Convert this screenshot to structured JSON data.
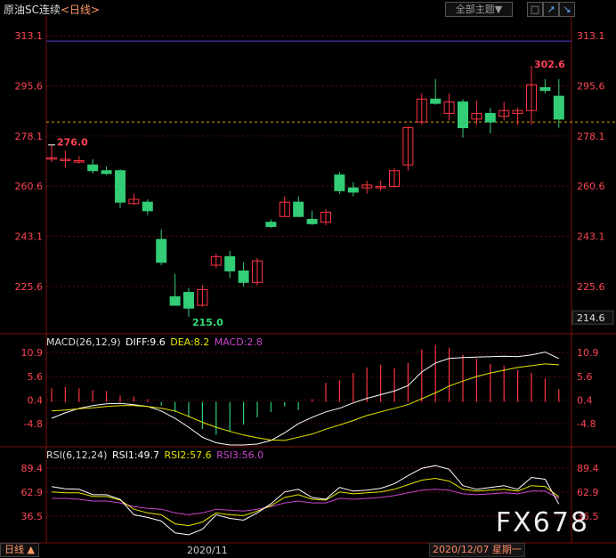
{
  "header": {
    "symbol": "原油SC连续",
    "timeframe": "<日线>",
    "theme_button": "全部主题▼",
    "btn_icons": [
      "window-icon",
      "chart-up-icon",
      "chart-down-icon"
    ]
  },
  "colors": {
    "up": "#ff3344",
    "down": "#33cc77",
    "dif": "#ffffff",
    "dea": "#e6e600",
    "macd": "#cc44cc",
    "rsi1": "#ffffff",
    "rsi2": "#e6e600",
    "rsi3": "#cc44cc",
    "grid": "#5a0d0d",
    "hline": "#5533bb",
    "refline": "#d4a000"
  },
  "chart_data": [
    {
      "type": "candlestick",
      "title": "原油SC连续 <日线>",
      "yticks": [
        313.1,
        295.6,
        278.1,
        260.6,
        243.1,
        225.6
      ],
      "ylim": [
        210.0,
        320.0
      ],
      "hline_top": 313.1,
      "ref_price": 283.0,
      "annotations": {
        "high": "302.6",
        "prev_high": "276.0",
        "low": "215.0",
        "last": "214.6"
      },
      "candles": [
        [
          270.5,
          275.0,
          269.0,
          270.5
        ],
        [
          270.0,
          273.0,
          267.0,
          270.0
        ],
        [
          269.0,
          271.0,
          268.5,
          269.5
        ],
        [
          268.0,
          270.0,
          265.0,
          266.0
        ],
        [
          266.0,
          267.5,
          264.5,
          265.0
        ],
        [
          266.0,
          266.5,
          253.0,
          255.0
        ],
        [
          254.5,
          258.0,
          254.0,
          256.0
        ],
        [
          255.0,
          256.0,
          250.5,
          252.0
        ],
        [
          242.0,
          245.5,
          233.0,
          234.0
        ],
        [
          222.0,
          230.0,
          220.0,
          219.0
        ],
        [
          223.5,
          225.0,
          215.0,
          218.0
        ],
        [
          219.0,
          226.0,
          218.5,
          224.5
        ],
        [
          233.0,
          237.0,
          232.0,
          236.0
        ],
        [
          236.0,
          238.0,
          228.5,
          231.0
        ],
        [
          231.0,
          234.0,
          225.5,
          227.0
        ],
        [
          227.0,
          235.5,
          226.0,
          234.5
        ],
        [
          248.0,
          249.0,
          246.0,
          246.5
        ],
        [
          250.0,
          257.0,
          250.0,
          255.0
        ],
        [
          255.0,
          257.0,
          250.0,
          250.0
        ],
        [
          249.0,
          252.0,
          247.0,
          247.5
        ],
        [
          248.0,
          252.5,
          247.0,
          251.5
        ],
        [
          264.5,
          265.5,
          258.0,
          259.0
        ],
        [
          260.0,
          262.0,
          257.0,
          258.5
        ],
        [
          260.0,
          262.5,
          258.0,
          261.0
        ],
        [
          260.0,
          262.5,
          259.0,
          260.5
        ],
        [
          260.5,
          267.0,
          260.0,
          266.0
        ],
        [
          268.0,
          281.5,
          266.0,
          281.0
        ],
        [
          283.0,
          293.0,
          282.0,
          291.0
        ],
        [
          291.0,
          298.0,
          289.0,
          289.5
        ],
        [
          286.0,
          293.0,
          283.5,
          290.0
        ],
        [
          290.0,
          291.0,
          277.5,
          281.0
        ],
        [
          284.0,
          290.5,
          282.0,
          286.0
        ],
        [
          286.0,
          288.0,
          279.0,
          283.0
        ],
        [
          285.0,
          290.0,
          283.5,
          287.0
        ],
        [
          286.0,
          288.0,
          282.0,
          287.0
        ],
        [
          287.0,
          302.6,
          282.0,
          296.0
        ],
        [
          295.0,
          298.0,
          293.0,
          294.0
        ],
        [
          292.0,
          298.0,
          281.0,
          284.0
        ]
      ]
    },
    {
      "type": "macd",
      "label": "MACD(26,12,9)",
      "dif_text": "DIFF:9.6",
      "dea_text": "DEA:8.2",
      "macd_text": "MACD:2.8",
      "yticks": [
        10.9,
        5.6,
        0.4,
        -4.8
      ],
      "ylim": [
        -9.5,
        12.5
      ],
      "dif": [
        -3.6,
        -2.4,
        -1.4,
        -0.8,
        -0.4,
        -0.3,
        -0.6,
        -1.0,
        -2.0,
        -3.6,
        -5.6,
        -7.8,
        -9.0,
        -9.5,
        -9.5,
        -9.3,
        -8.5,
        -6.8,
        -4.8,
        -3.4,
        -2.2,
        -1.4,
        -0.2,
        0.8,
        1.6,
        2.4,
        3.6,
        6.6,
        8.6,
        9.6,
        9.8,
        9.9,
        10.0,
        10.1,
        10.0,
        10.4,
        11.0,
        9.6
      ],
      "dea": [
        -2.0,
        -1.8,
        -1.5,
        -1.3,
        -1.0,
        -0.8,
        -0.8,
        -1.0,
        -1.4,
        -2.0,
        -3.2,
        -4.5,
        -5.6,
        -6.5,
        -7.3,
        -7.9,
        -8.4,
        -8.5,
        -7.8,
        -7.1,
        -6.0,
        -5.1,
        -4.1,
        -3.0,
        -2.2,
        -1.4,
        -0.6,
        0.7,
        2.0,
        3.5,
        4.6,
        5.6,
        6.4,
        7.0,
        7.6,
        8.0,
        8.4,
        8.2
      ],
      "hist": [
        3.0,
        3.3,
        3.0,
        2.6,
        2.4,
        1.4,
        1.2,
        0.6,
        -0.8,
        -2.2,
        -3.4,
        -6.0,
        -7.2,
        -6.6,
        -5.0,
        -3.4,
        -2.2,
        -1.0,
        -1.8,
        0.6,
        4.2,
        4.8,
        6.4,
        7.6,
        8.2,
        7.4,
        8.6,
        11.6,
        12.6,
        12.0,
        10.4,
        9.6,
        8.4,
        8.0,
        7.0,
        6.4,
        5.2,
        2.8
      ]
    },
    {
      "type": "rsi",
      "label": "RSI(6,12,24)",
      "rsi1_text": "RSI1:49.7",
      "rsi2_text": "RSI2:57.6",
      "rsi3_text": "RSI3:56.0",
      "yticks": [
        89.4,
        62.9,
        36.5
      ],
      "ylim": [
        10.0,
        100.0
      ],
      "rsi1": [
        69.0,
        66.5,
        66.0,
        60.0,
        60.0,
        55.0,
        38.0,
        35.0,
        31.0,
        18.0,
        16.0,
        22.0,
        38.0,
        34.0,
        32.0,
        40.0,
        50.0,
        63.0,
        66.0,
        57.0,
        55.0,
        68.0,
        64.0,
        65.0,
        67.0,
        72.0,
        81.0,
        89.0,
        92.0,
        88.0,
        70.0,
        66.0,
        68.0,
        70.0,
        66.0,
        79.0,
        77.0,
        49.7
      ],
      "rsi2": [
        63.0,
        62.0,
        62.0,
        58.0,
        58.0,
        54.0,
        44.0,
        40.0,
        38.0,
        28.0,
        26.0,
        30.0,
        40.0,
        38.0,
        37.0,
        42.0,
        48.0,
        57.0,
        60.0,
        55.0,
        54.0,
        63.0,
        61.0,
        62.0,
        63.0,
        66.0,
        71.0,
        76.0,
        78.0,
        75.0,
        66.0,
        64.0,
        65.0,
        66.0,
        64.0,
        70.0,
        69.0,
        57.6
      ],
      "rsi3": [
        56.0,
        56.0,
        55.0,
        53.0,
        53.0,
        51.0,
        47.0,
        45.0,
        44.0,
        40.0,
        38.0,
        40.0,
        44.0,
        43.0,
        42.0,
        44.0,
        47.0,
        51.0,
        53.0,
        51.0,
        51.0,
        56.0,
        55.0,
        56.0,
        57.0,
        59.0,
        62.0,
        65.0,
        66.0,
        65.0,
        61.0,
        60.0,
        61.0,
        62.0,
        61.0,
        64.0,
        64.0,
        56.0
      ]
    }
  ],
  "footer": {
    "period_btn": "日线 ▲",
    "center_date": "2020/11",
    "cursor_date": "2020/12/07 星期一",
    "watermark": "FX678"
  }
}
